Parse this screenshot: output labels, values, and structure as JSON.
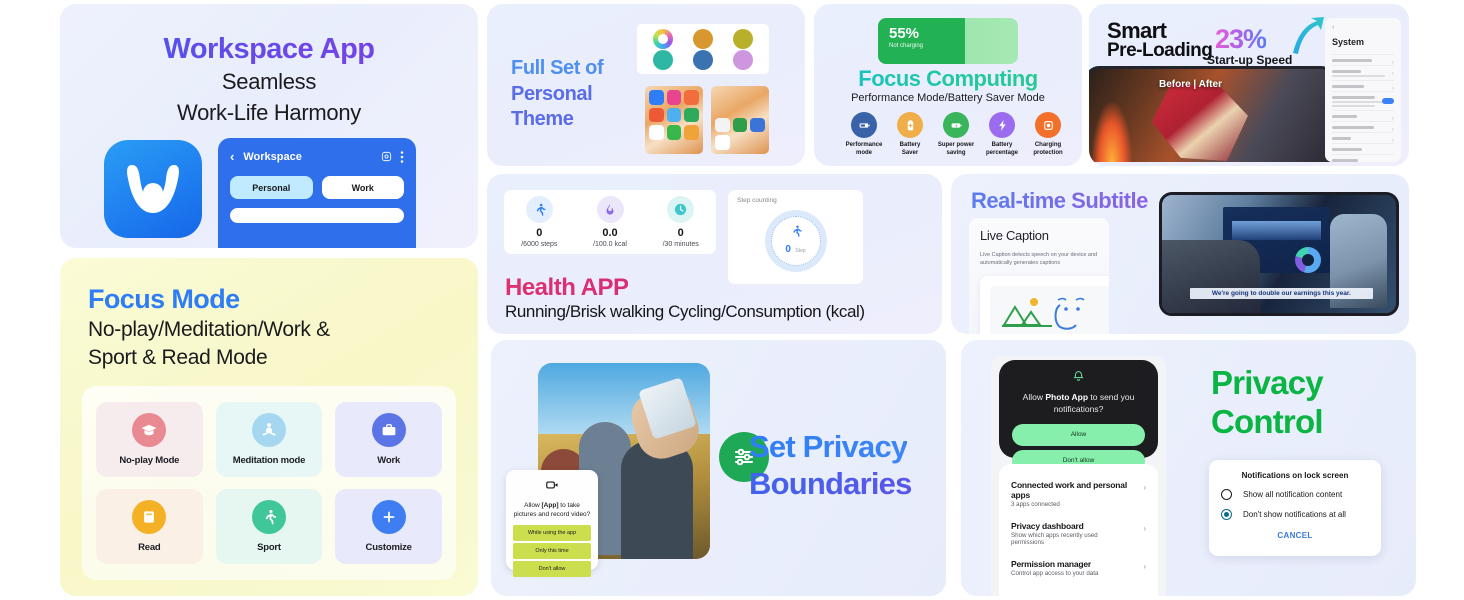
{
  "workspace": {
    "title": "Workspace App",
    "subtitle_line1": "Seamless",
    "subtitle_line2": "Work-Life Harmony",
    "phone": {
      "header_title": "Workspace",
      "tab_personal": "Personal",
      "tab_work": "Work"
    }
  },
  "focus_mode": {
    "title": "Focus Mode",
    "subtitle_line1": "No-play/Meditation/Work &",
    "subtitle_line2": "Sport & Read Mode",
    "tiles": [
      {
        "label": "No-play Mode",
        "icon": "graduation-cap-icon",
        "tile_bg": "#f6ecee",
        "circle": "#e98a92"
      },
      {
        "label": "Meditation mode",
        "icon": "meditation-icon",
        "tile_bg": "#e6f7f6",
        "circle": "#a5d8f0"
      },
      {
        "label": "Work",
        "icon": "briefcase-icon",
        "tile_bg": "#e8eafb",
        "circle": "#5b74e6"
      },
      {
        "label": "Read",
        "icon": "book-icon",
        "tile_bg": "#fbf0e6",
        "circle": "#f5b125"
      },
      {
        "label": "Sport",
        "icon": "running-icon",
        "tile_bg": "#e6f6f1",
        "circle": "#3fc79a"
      },
      {
        "label": "Customize",
        "icon": "plus-icon",
        "tile_bg": "#e8eafb",
        "circle": "#3f7ef2"
      }
    ]
  },
  "theme": {
    "title_line1": "Full Set of",
    "title_line2": "Personal",
    "title_line3": "Theme",
    "swatches": [
      "rainbow",
      "#d9982f",
      "#b8b02a",
      "#2eb8a4",
      "#3a74b0",
      "#cf96e0"
    ]
  },
  "focus_computing": {
    "battery_percent": "55%",
    "battery_status": "Not charging",
    "title": "Focus Computing",
    "subtitle": "Performance Mode/Battery Saver Mode",
    "modes": [
      {
        "label_line1": "Performance",
        "label_line2": "mode",
        "icon": "performance-icon",
        "color": "#3a62a8"
      },
      {
        "label_line1": "Battery",
        "label_line2": "Saver",
        "icon": "battery-plus-icon",
        "color": "#f0ae4a"
      },
      {
        "label_line1": "Super power",
        "label_line2": "saving",
        "icon": "battery-bolt-icon",
        "color": "#3ab55c"
      },
      {
        "label_line1": "Battery",
        "label_line2": "percentage",
        "icon": "bolt-icon",
        "color": "#9b6cf0"
      },
      {
        "label_line1": "Charging",
        "label_line2": "protection",
        "icon": "chip-protection-icon",
        "color": "#f2702a"
      }
    ]
  },
  "preloading": {
    "title_line1": "Smart",
    "title_line2": "Pre-Loading",
    "percent": "23%",
    "percent_caption": "Start-up Speed",
    "game_overlay": "Before | After",
    "settings": {
      "title": "System",
      "rows": 9
    }
  },
  "health": {
    "stats": [
      {
        "value": "0",
        "sub": "/6000 steps",
        "icon": "running-icon",
        "ring": "#e3efff",
        "fg": "#2f7df6"
      },
      {
        "value": "0.0",
        "sub": "/100.0 kcal",
        "icon": "flame-icon",
        "ring": "#ece6fb",
        "fg": "#8a6be8"
      },
      {
        "value": "0",
        "sub": "/30 minutes",
        "icon": "clock-icon",
        "ring": "#dcf4f3",
        "fg": "#3ec7cc"
      }
    ],
    "step_widget": {
      "label": "Step counting",
      "value": "0",
      "unit": "Step"
    },
    "title": "Health APP",
    "description": "Running/Brisk walking Cycling/Consumption (kcal)"
  },
  "subtitle_card": {
    "title": "Real-time Subtitle",
    "live_caption_title": "Live Caption",
    "live_caption_desc": "Live Caption detects speech on your device and automatically generates captions",
    "phone_caption": "We're going to double our earnings this year."
  },
  "privacy_boundaries": {
    "title_line1": "Set Privacy",
    "title_line2": "Boundaries",
    "badge_icon": "sliders-icon",
    "dialog": {
      "icon": "camera-icon",
      "question_prefix": "Allow ",
      "question_app": "[App]",
      "question_suffix": " to take pictures and record video?",
      "buttons": [
        "While using the app",
        "Only this time",
        "Don't allow"
      ]
    }
  },
  "privacy_control": {
    "title_line1": "Privacy",
    "title_line2": "Control",
    "notification_sheet": {
      "icon": "bell-icon",
      "question_prefix": "Allow ",
      "question_app": "Photo App",
      "question_suffix": " to send you notifications?",
      "buttons": [
        "Allow",
        "Don't allow"
      ]
    },
    "settings_rows": [
      {
        "title": "Connected work and personal apps",
        "desc": "3 apps connected"
      },
      {
        "title": "Privacy dashboard",
        "desc": "Show which apps recently used permissions"
      },
      {
        "title": "Permission manager",
        "desc": "Control app access to your data"
      }
    ],
    "dialog": {
      "title": "Notifications on lock screen",
      "options": [
        {
          "label": "Show all notification content",
          "selected": false
        },
        {
          "label": "Don't show notifications at all",
          "selected": true
        }
      ],
      "cancel": "CANCEL"
    }
  }
}
